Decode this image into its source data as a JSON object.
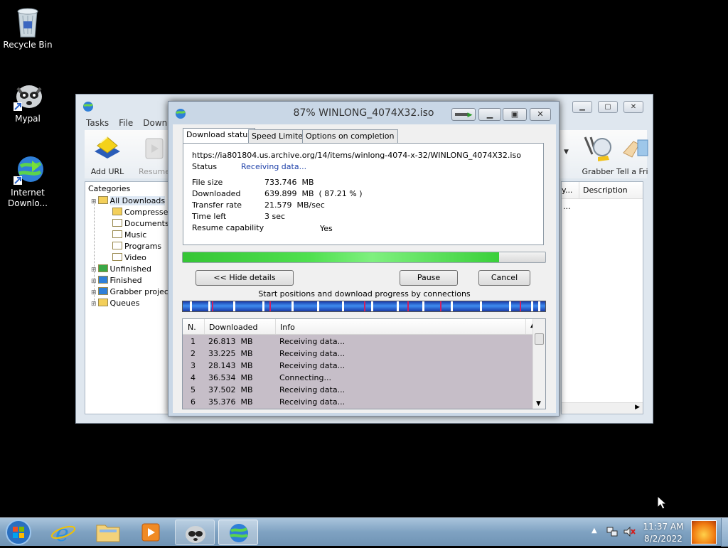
{
  "desktop": {
    "icons": [
      {
        "label": "Recycle Bin"
      },
      {
        "label": "Mypal"
      },
      {
        "label": "Internet Downlo..."
      }
    ]
  },
  "main_window": {
    "menu": [
      "Tasks",
      "File",
      "Downlo"
    ],
    "toolbar": {
      "add_url": "Add URL",
      "resume": "Resume",
      "grabber": "Grabber",
      "tell_friend": "Tell a Fri"
    },
    "categories": {
      "header": "Categories",
      "items": [
        {
          "label": "All Downloads",
          "level": 0
        },
        {
          "label": "Compresse",
          "level": 1
        },
        {
          "label": "Documents",
          "level": 1
        },
        {
          "label": "Music",
          "level": 1
        },
        {
          "label": "Programs",
          "level": 1
        },
        {
          "label": "Video",
          "level": 1
        },
        {
          "label": "Unfinished",
          "level": 0
        },
        {
          "label": "Finished",
          "level": 0
        },
        {
          "label": "Grabber projec",
          "level": 0
        },
        {
          "label": "Queues",
          "level": 0
        }
      ]
    },
    "list": {
      "col_partial": "y...",
      "col_description": "Description",
      "cell_partial": "..."
    }
  },
  "dialog": {
    "title": "87% WINLONG_4074X32.iso",
    "tabs": [
      "Download status",
      "Speed Limiter",
      "Options on completion"
    ],
    "url": "https://ia801804.us.archive.org/14/items/winlong-4074-x-32/WINLONG_4074X32.iso",
    "status_label": "Status",
    "status_value": "Receiving data...",
    "fields": [
      {
        "label": "File size",
        "value": "733.746  MB"
      },
      {
        "label": "Downloaded",
        "value": "639.899  MB  ( 87.21 % )"
      },
      {
        "label": "Transfer rate",
        "value": "21.579  MB/sec"
      },
      {
        "label": "Time left",
        "value": "3 sec"
      },
      {
        "label": "Resume capability",
        "value": "Yes"
      }
    ],
    "progress": 0.8721,
    "buttons": {
      "hide_details": "<< Hide details",
      "pause": "Pause",
      "cancel": "Cancel"
    },
    "connections_caption": "Start positions and download progress by connections",
    "table": {
      "headers": [
        "N.",
        "Downloaded",
        "Info"
      ],
      "rows": [
        {
          "n": "1",
          "downloaded": "26.813  MB",
          "info": "Receiving data..."
        },
        {
          "n": "2",
          "downloaded": "33.225  MB",
          "info": "Receiving data..."
        },
        {
          "n": "3",
          "downloaded": "28.143  MB",
          "info": "Receiving data..."
        },
        {
          "n": "4",
          "downloaded": "36.534  MB",
          "info": "Connecting..."
        },
        {
          "n": "5",
          "downloaded": "37.502  MB",
          "info": "Receiving data..."
        },
        {
          "n": "6",
          "downloaded": "35.376  MB",
          "info": "Receiving data..."
        }
      ]
    }
  },
  "taskbar": {
    "time": "11:37 AM",
    "date": "8/2/2022"
  }
}
